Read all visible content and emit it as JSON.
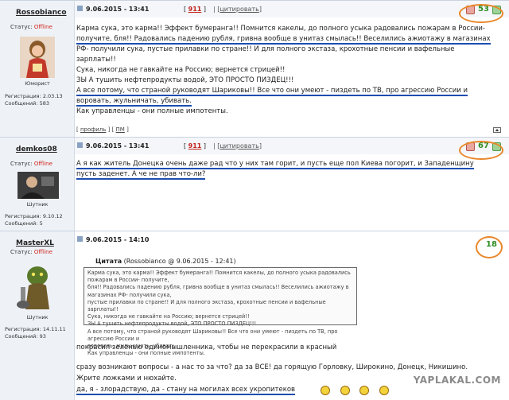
{
  "posts": [
    {
      "username": "Rossobianco",
      "status_label": "Статус:",
      "status_value": "Offline",
      "role": "Юморист",
      "registration": "Регистрация: 2.03.13",
      "messages": "Сообщений: 583",
      "date": "9.06.2015 - 13:41",
      "count": "911",
      "cite_label": "цитировать",
      "rating": "53",
      "text": [
        "Карма сука, это карма!! Эффект бумеранга!! Помнится какелы, до полного усыка радовались пожарам в России-",
        "получите, бля!! Радовались падению рубля, гривна вообще в унитаз смылась!! Веселились ажиотажу в магазинах",
        "РФ- получили сука, пустые прилавки по стране!! И для полного экстаза, крохотные пенсии и вафельные",
        "зарплаты!!",
        "Сука, никогда не гавкайте на Россию; вернется стрицей!!",
        "ЗЫ А тушить нефтепродукты водой, ЭТО ПРОСТО ПИЗДЕЦ!!!",
        "А все потому, что страной руководят Шариковы!! Все что они умеют - пиздеть по ТВ, про агрессию России и",
        "воровать, жульничать, убивать.",
        "Как управленцы - они полные импотенты."
      ],
      "profile_link": "профиль",
      "pm_link": "ПМ"
    },
    {
      "username": "demkos08",
      "status_label": "Статус:",
      "status_value": "Offline",
      "role": "Шутник",
      "registration": "Регистрация: 9.10.12",
      "messages": "Сообщений: 5",
      "date": "9.06.2015 - 13:41",
      "count": "911",
      "cite_label": "цитировать",
      "rating": "67",
      "text": [
        "А я как житель Донецка очень даже рад что у них там горит, и пусть еще пол Киева погорит, и Западенщину",
        "пусть заденет. А че не прав что-ли?"
      ]
    },
    {
      "username": "MasterXL",
      "status_label": "Статус:",
      "status_value": "Offline",
      "role": "Шутник",
      "registration": "Регистрация: 14.11.11",
      "messages": "Сообщений: 93",
      "date": "9.06.2015 - 14:10",
      "rating": "18",
      "quote_title_label": "Цитата",
      "quote_title_rest": "(Rossobianco @ 9.06.2015 - 12:41)",
      "quote": [
        "Карма сука, это карма!! Эффект бумеранга!! Помнится какелы, до полного усыка радовались пожарам в России- получите,",
        "бля!! Радовались падению рубля, гривна вообще в унитаз смылась!! Веселились ажиотажу в магазинах РФ- получили сука,",
        "пустые прилавки по стране!! И для полного экстаза, крохотные пенсии и вафельные зарплаты!!",
        "Сука, никогда не гавкайте на Россию; вернется стрицей!!",
        "ЗЫ А тушить нефтепродукты водой, ЭТО ПРОСТО ПИЗДЕЦ!!!",
        "А все потому, что страной руководят Шариковы!! Все что они умеют - пиздеть по ТВ, про агрессию России и",
        "воровать, жульничать, убивать.",
        "Как управленцы - они полные импотенты."
      ],
      "line1": "покрасил зеленью единомышленника, чтобы не перекрасили в красный",
      "line2": "сразу возникают вопросы - а нас то за что? да за ВСЕ! да горящую Горловку, Широкино, Донецк, Никишино.",
      "line3": "Жрите ложками и нюхайте.",
      "line4": "да, я - злорадствую, да - стану на могилах всех укропитеков"
    }
  ],
  "watermark": "YAPLAKAL.COM",
  "colors": {
    "rating_green": "#2f8c22",
    "offline_red": "#d0241b",
    "annotation_orange": "#e9872a",
    "annotation_blue": "#1d4db0"
  }
}
